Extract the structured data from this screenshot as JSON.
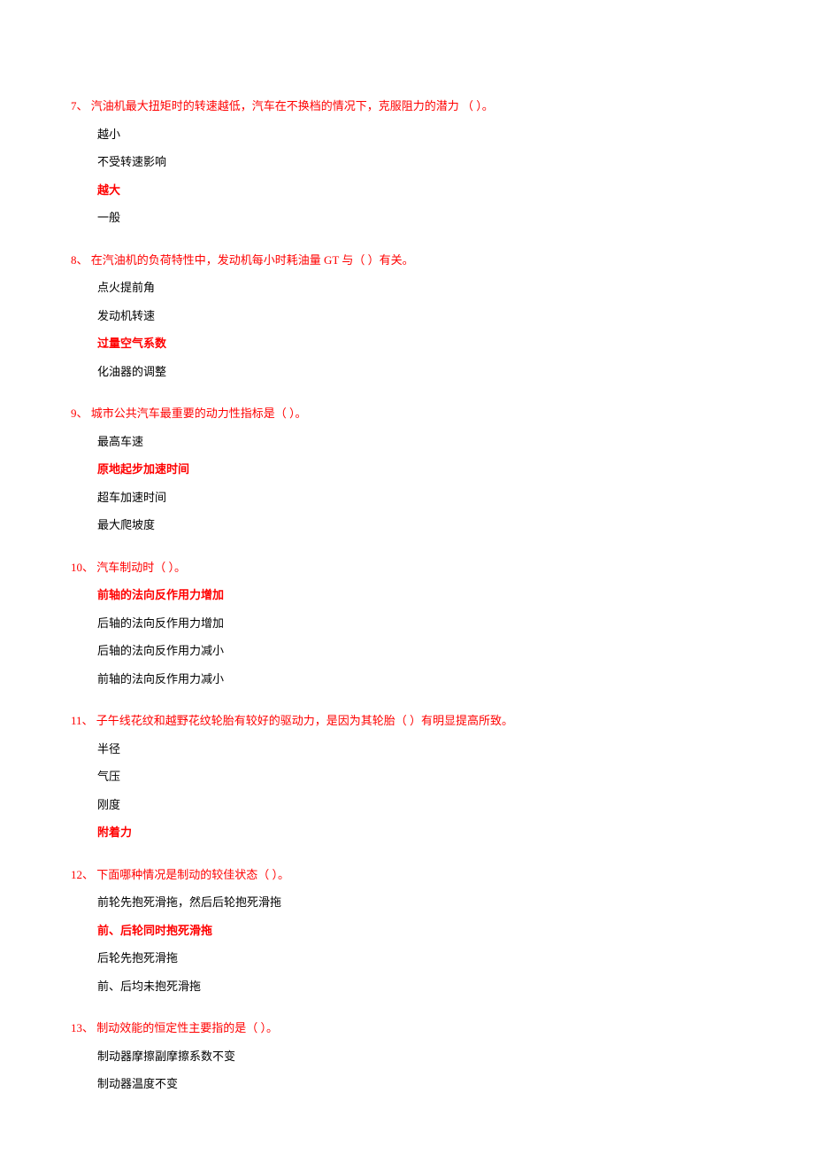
{
  "questions": [
    {
      "number": "7、",
      "text": " 汽油机最大扭矩时的转速越低，汽车在不换档的情况下，克服阻力的潜力 （ ）。",
      "options": [
        {
          "text": "越小",
          "correct": false
        },
        {
          "text": "不受转速影响",
          "correct": false
        },
        {
          "text": "越大",
          "correct": true
        },
        {
          "text": "一般",
          "correct": false
        }
      ]
    },
    {
      "number": "8、",
      "text": " 在汽油机的负荷特性中，发动机每小时耗油量 GT 与（ ）有关。",
      "options": [
        {
          "text": "点火提前角",
          "correct": false
        },
        {
          "text": "发动机转速",
          "correct": false
        },
        {
          "text": "过量空气系数",
          "correct": true
        },
        {
          "text": "化油器的调整",
          "correct": false
        }
      ]
    },
    {
      "number": "9、",
      "text": " 城市公共汽车最重要的动力性指标是（ ）。",
      "options": [
        {
          "text": "最高车速",
          "correct": false
        },
        {
          "text": "原地起步加速时间",
          "correct": true
        },
        {
          "text": "超车加速时间",
          "correct": false
        },
        {
          "text": "最大爬坡度",
          "correct": false
        }
      ]
    },
    {
      "number": "10、",
      "text": " 汽车制动时（ ）。",
      "options": [
        {
          "text": "前轴的法向反作用力增加",
          "correct": true
        },
        {
          "text": "后轴的法向反作用力增加",
          "correct": false
        },
        {
          "text": "后轴的法向反作用力减小",
          "correct": false
        },
        {
          "text": "前轴的法向反作用力减小",
          "correct": false
        }
      ]
    },
    {
      "number": "11、",
      "text": " 子午线花纹和越野花纹轮胎有较好的驱动力，是因为其轮胎（ ）有明显提高所致。",
      "options": [
        {
          "text": "半径",
          "correct": false
        },
        {
          "text": "气压",
          "correct": false
        },
        {
          "text": "刚度",
          "correct": false
        },
        {
          "text": "附着力",
          "correct": true
        }
      ]
    },
    {
      "number": "12、",
      "text": " 下面哪种情况是制动的较佳状态（ ）。",
      "options": [
        {
          "text": "前轮先抱死滑拖，然后后轮抱死滑拖",
          "correct": false
        },
        {
          "text": "前、后轮同时抱死滑拖",
          "correct": true
        },
        {
          "text": "后轮先抱死滑拖",
          "correct": false
        },
        {
          "text": "前、后均未抱死滑拖",
          "correct": false
        }
      ]
    },
    {
      "number": "13、",
      "text": " 制动效能的恒定性主要指的是（ ）。",
      "options": [
        {
          "text": "制动器摩擦副摩擦系数不变",
          "correct": false
        },
        {
          "text": "制动器温度不变",
          "correct": false
        }
      ]
    }
  ]
}
